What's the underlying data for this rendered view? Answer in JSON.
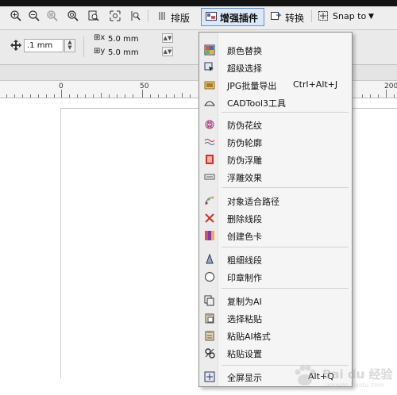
{
  "toolbar": {
    "layout_label": "排版",
    "plugin_label": "增强插件",
    "convert_label": "转换",
    "snap_label": "Snap to"
  },
  "property_bar": {
    "nudge_value": ".1 mm",
    "dup_x_value": "5.0 mm",
    "dup_y_value": "5.0 mm"
  },
  "ruler": {
    "labels": [
      "0",
      "50",
      "200"
    ]
  },
  "menu": {
    "items": [
      {
        "label": "颜色替换",
        "icon": "color-replace-icon"
      },
      {
        "label": "超级选择",
        "icon": "super-select-icon"
      },
      {
        "label": "JPG批量导出",
        "shortcut": "Ctrl+Alt+J",
        "icon": "jpg-export-icon"
      },
      {
        "label": "CADTool3工具",
        "icon": "cadtool-icon"
      },
      {
        "label": "防伪花纹",
        "icon": "guilloche-icon"
      },
      {
        "label": "防伪轮廓",
        "icon": "wave-contour-icon"
      },
      {
        "label": "防伪浮雕",
        "icon": "emboss-icon"
      },
      {
        "label": "浮雕效果",
        "icon": "relief-icon"
      },
      {
        "label": "对象适合路径",
        "icon": "fit-path-icon"
      },
      {
        "label": "删除线段",
        "icon": "delete-segment-icon"
      },
      {
        "label": "创建色卡",
        "icon": "color-card-icon"
      },
      {
        "label": "粗细线段",
        "icon": "line-weight-icon"
      },
      {
        "label": "印章制作",
        "icon": "seal-icon"
      },
      {
        "label": "复制为AI",
        "icon": "copy-ai-icon"
      },
      {
        "label": "选择粘贴",
        "icon": "paste-special-icon"
      },
      {
        "label": "粘贴AI格式",
        "icon": "paste-ai-icon"
      },
      {
        "label": "粘贴设置",
        "icon": "paste-settings-icon"
      },
      {
        "label": "全屏显示",
        "shortcut": "Alt+Q",
        "icon": "fullscreen-icon"
      }
    ]
  },
  "watermark": {
    "brand": "Bai du 经验",
    "url": "jingyan.baidu.com"
  },
  "colors": {
    "active_button_bg": "#dbe8f7",
    "menu_bg": "#f5f5f5",
    "toolbar_bg": "#eeeeee"
  }
}
